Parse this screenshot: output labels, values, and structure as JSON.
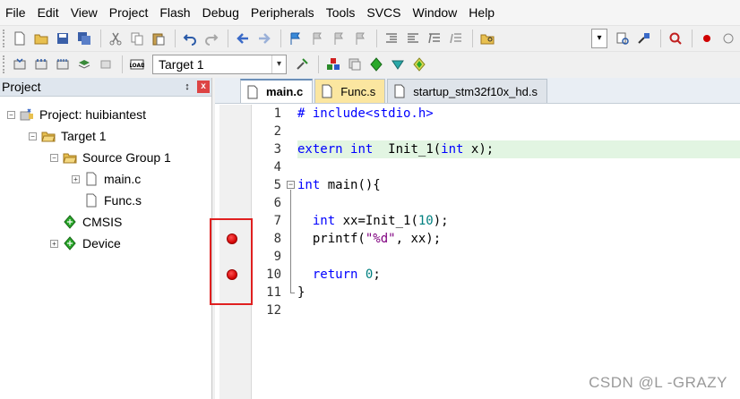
{
  "menu": [
    "File",
    "Edit",
    "View",
    "Project",
    "Flash",
    "Debug",
    "Peripherals",
    "Tools",
    "SVCS",
    "Window",
    "Help"
  ],
  "toolbar": {
    "target_select_value": "Target 1"
  },
  "project_panel": {
    "title": "Project",
    "pin_glyph": "↕",
    "close_glyph": "x",
    "tree": {
      "project_label": "Project: huibiantest",
      "target_label": "Target 1",
      "group_label": "Source Group 1",
      "file_main": "main.c",
      "file_func": "Func.s",
      "cmsis_label": "CMSIS",
      "device_label": "Device"
    }
  },
  "tabs": [
    {
      "label": "main.c",
      "active": true
    },
    {
      "label": "Func.s",
      "active": false
    },
    {
      "label": "startup_stm32f10x_hd.s",
      "active": false
    }
  ],
  "editor": {
    "line_numbers": [
      "1",
      "2",
      "3",
      "4",
      "5",
      "6",
      "7",
      "8",
      "9",
      "10",
      "11",
      "12"
    ],
    "breakpoint_lines": [
      8,
      10
    ],
    "highlighted_line": 3,
    "code": {
      "l1": "# include<stdio.h>",
      "l3_kw1": "extern",
      "l3_kw2": "int",
      "l3_mid": "  Init_1(",
      "l3_kw3": "int",
      "l3_end": " x);",
      "l5_kw": "int",
      "l5_rest": " main(){",
      "l7_kw": "int",
      "l7_mid": " xx=Init_1(",
      "l7_num": "10",
      "l7_end": ");",
      "l8_pre": "printf(",
      "l8_str": "\"%d\"",
      "l8_end": ", xx);",
      "l10_kw": "return",
      "l10_num": "0",
      "l10_end": ";",
      "l11": "}"
    }
  },
  "watermark": "CSDN @L -GRAZY",
  "colors": {
    "keyword": "#0000ff",
    "number": "#008080",
    "string": "#800080",
    "breakpoint": "#e00000",
    "highlight_line": "#e2f5e2"
  }
}
